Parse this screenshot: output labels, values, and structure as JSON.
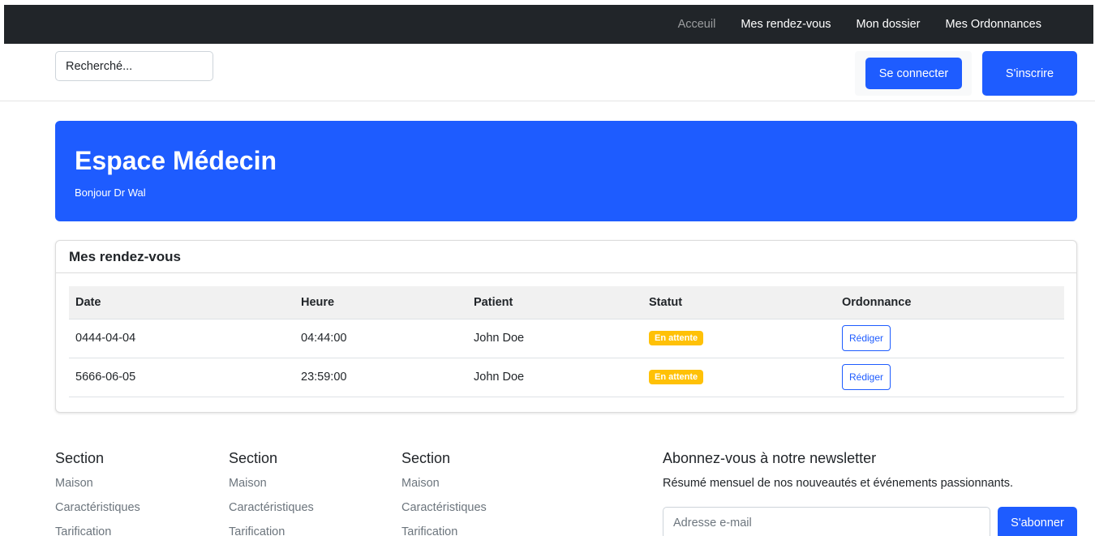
{
  "nav": {
    "items": [
      {
        "label": "Acceuil"
      },
      {
        "label": "Mes rendez-vous"
      },
      {
        "label": "Mon dossier"
      },
      {
        "label": "Mes Ordonnances"
      }
    ]
  },
  "header": {
    "search_placeholder": "Recherché...",
    "login_label": "Se connecter",
    "signup_label": "S'inscrire"
  },
  "hero": {
    "title": "Espace Médecin",
    "subtitle": "Bonjour Dr Wal"
  },
  "appointments": {
    "title": "Mes rendez-vous",
    "columns": [
      "Date",
      "Heure",
      "Patient",
      "Statut",
      "Ordonnance"
    ],
    "rows": [
      {
        "date": "0444-04-04",
        "time": "04:44:00",
        "patient": "John Doe",
        "status": "En attente",
        "action": "Rédiger"
      },
      {
        "date": "5666-06-05",
        "time": "23:59:00",
        "patient": "John Doe",
        "status": "En attente",
        "action": "Rédiger"
      }
    ]
  },
  "footer": {
    "sections": [
      {
        "title": "Section",
        "links": [
          "Maison",
          "Caractéristiques",
          "Tarification"
        ]
      },
      {
        "title": "Section",
        "links": [
          "Maison",
          "Caractéristiques",
          "Tarification"
        ]
      },
      {
        "title": "Section",
        "links": [
          "Maison",
          "Caractéristiques",
          "Tarification"
        ]
      }
    ],
    "newsletter": {
      "title": "Abonnez-vous à notre newsletter",
      "description": "Résumé mensuel de nos nouveautés et événements passionnants.",
      "email_placeholder": "Adresse e-mail",
      "subscribe_label": "S'abonner"
    }
  },
  "colors": {
    "primary": "#1e5cff",
    "navbar": "#212529",
    "warning": "#ffc107"
  }
}
